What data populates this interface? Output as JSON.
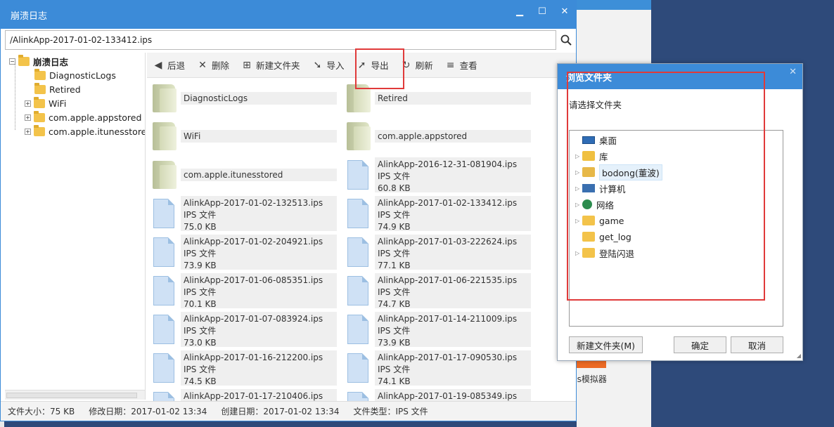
{
  "window": {
    "title": "崩溃日志",
    "address": "/AlinkApp-2017-01-02-133412.ips"
  },
  "tree": {
    "root": "崩溃日志",
    "items": [
      "DiagnosticLogs",
      "Retired",
      "WiFi",
      "com.apple.appstored",
      "com.apple.itunesstored"
    ]
  },
  "toolbar": {
    "back": "后退",
    "delete": "删除",
    "new_folder": "新建文件夹",
    "import": "导入",
    "export": "导出",
    "refresh": "刷新",
    "view": "查看"
  },
  "folders": [
    "DiagnosticLogs",
    "Retired",
    "WiFi",
    "com.apple.appstored",
    "com.apple.itunesstored"
  ],
  "files": [
    {
      "name": "AlinkApp-2016-12-31-081904.ips",
      "type": "IPS 文件",
      "size": "60.8 KB"
    },
    {
      "name": "AlinkApp-2017-01-02-132513.ips",
      "type": "IPS 文件",
      "size": "75.0 KB"
    },
    {
      "name": "AlinkApp-2017-01-02-133412.ips",
      "type": "IPS 文件",
      "size": "74.9 KB"
    },
    {
      "name": "AlinkApp-2017-01-02-204921.ips",
      "type": "IPS 文件",
      "size": "73.9 KB"
    },
    {
      "name": "AlinkApp-2017-01-03-222624.ips",
      "type": "IPS 文件",
      "size": "77.1 KB"
    },
    {
      "name": "AlinkApp-2017-01-06-085351.ips",
      "type": "IPS 文件",
      "size": "70.1 KB"
    },
    {
      "name": "AlinkApp-2017-01-06-221535.ips",
      "type": "IPS 文件",
      "size": "74.7 KB"
    },
    {
      "name": "AlinkApp-2017-01-07-083924.ips",
      "type": "IPS 文件",
      "size": "73.0 KB"
    },
    {
      "name": "AlinkApp-2017-01-14-211009.ips",
      "type": "IPS 文件",
      "size": "73.9 KB"
    },
    {
      "name": "AlinkApp-2017-01-16-212200.ips",
      "type": "IPS 文件",
      "size": "74.5 KB"
    },
    {
      "name": "AlinkApp-2017-01-17-090530.ips",
      "type": "IPS 文件",
      "size": "74.1 KB"
    },
    {
      "name": "AlinkApp-2017-01-17-210406.ips",
      "type": "",
      "size": ""
    },
    {
      "name": "AlinkApp-2017-01-19-085349.ips",
      "type": "",
      "size": ""
    }
  ],
  "status": {
    "size": "文件大小：75 KB",
    "modified": "修改日期：2017-01-02 13:34",
    "created": "创建日期：2017-01-02 13:34",
    "type": "文件类型：IPS 文件"
  },
  "dialog": {
    "title": "浏览文件夹",
    "prompt": "请选择文件夹",
    "items": [
      "桌面",
      "库",
      "bodong(董波)",
      "计算机",
      "网络",
      "game",
      "get_log",
      "登陆闪退"
    ],
    "new_folder": "新建文件夹(M)",
    "ok": "确定",
    "cancel": "取消"
  },
  "background": {
    "label": "ols模拟器"
  }
}
